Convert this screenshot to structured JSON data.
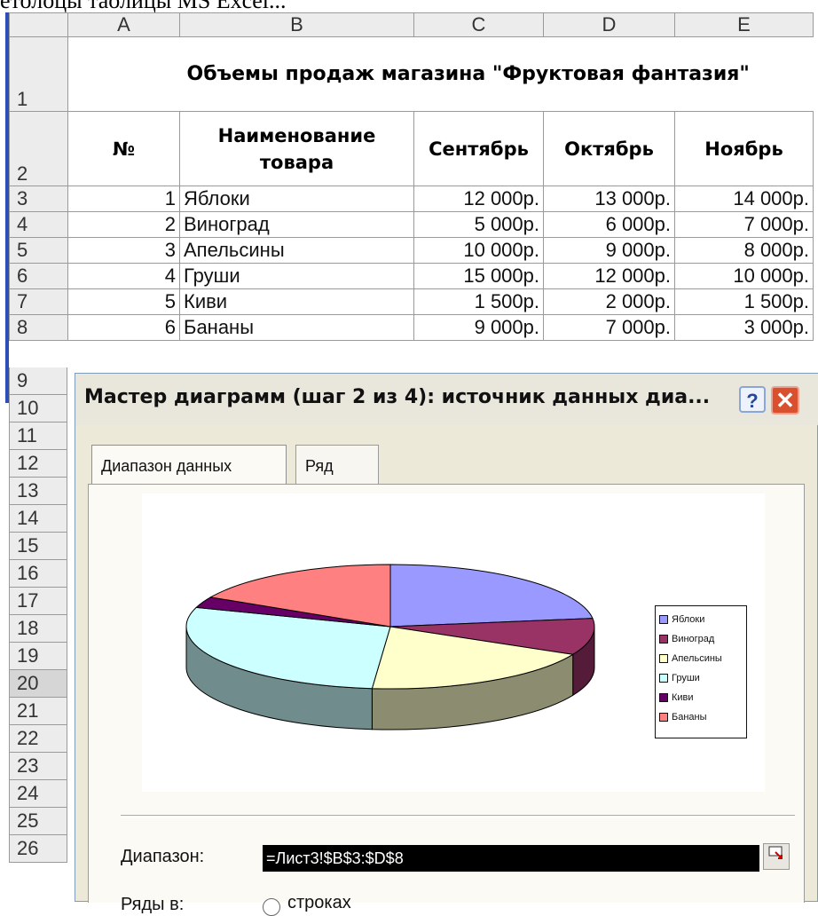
{
  "caption": "етолоцы таолицы MS Excel...",
  "spreadsheet": {
    "column_headers": [
      "A",
      "B",
      "C",
      "D",
      "E"
    ],
    "row_numbers": [
      "1",
      "2",
      "3",
      "4",
      "5",
      "6",
      "7",
      "8",
      "9",
      "10",
      "11",
      "12",
      "13",
      "14",
      "15",
      "16",
      "17",
      "18",
      "19",
      "20",
      "21",
      "22",
      "23",
      "24",
      "25",
      "26"
    ],
    "selected_row": "20",
    "title": "Объемы продаж магазина  \"Фруктовая фантазия\"",
    "header": {
      "num": "№",
      "name": "Наименование товара",
      "sep": "Сентябрь",
      "oct": "Октябрь",
      "nov": "Ноябрь"
    },
    "rows": [
      {
        "num": "1",
        "name": "Яблоки",
        "sep": "12 000р.",
        "oct": "13 000р.",
        "nov": "14 000р."
      },
      {
        "num": "2",
        "name": "Виноград",
        "sep": "5 000р.",
        "oct": "6 000р.",
        "nov": "7 000р."
      },
      {
        "num": "3",
        "name": "Апельсины",
        "sep": "10 000р.",
        "oct": "9 000р.",
        "nov": "8 000р."
      },
      {
        "num": "4",
        "name": "Груши",
        "sep": "15 000р.",
        "oct": "12 000р.",
        "nov": "10 000р."
      },
      {
        "num": "5",
        "name": "Киви",
        "sep": "1 500р.",
        "oct": "2 000р.",
        "nov": "1 500р."
      },
      {
        "num": "6",
        "name": "Бананы",
        "sep": "9 000р.",
        "oct": "7 000р.",
        "nov": "3 000р."
      }
    ]
  },
  "dialog": {
    "title": "Мастер диаграмм (шаг 2 из 4): источник данных диа...",
    "help_label": "?",
    "close_label": "✕",
    "tabs": [
      "Диапазон данных",
      "Ряд"
    ],
    "range_label": "Диапазон:",
    "range_value": "=Лист3!$B$3:$D$8",
    "series_label": "Ряды в:",
    "series_option": "строках"
  },
  "chart_data": {
    "type": "pie",
    "categories": [
      "Яблоки",
      "Виноград",
      "Апельсины",
      "Груши",
      "Киви",
      "Бананы"
    ],
    "values": [
      12000,
      5000,
      10000,
      15000,
      1500,
      9000
    ],
    "colors": [
      "#9999ff",
      "#993366",
      "#ffffcc",
      "#ccffff",
      "#660066",
      "#ff8080"
    ],
    "legend_placement": "right",
    "style": "3d"
  }
}
